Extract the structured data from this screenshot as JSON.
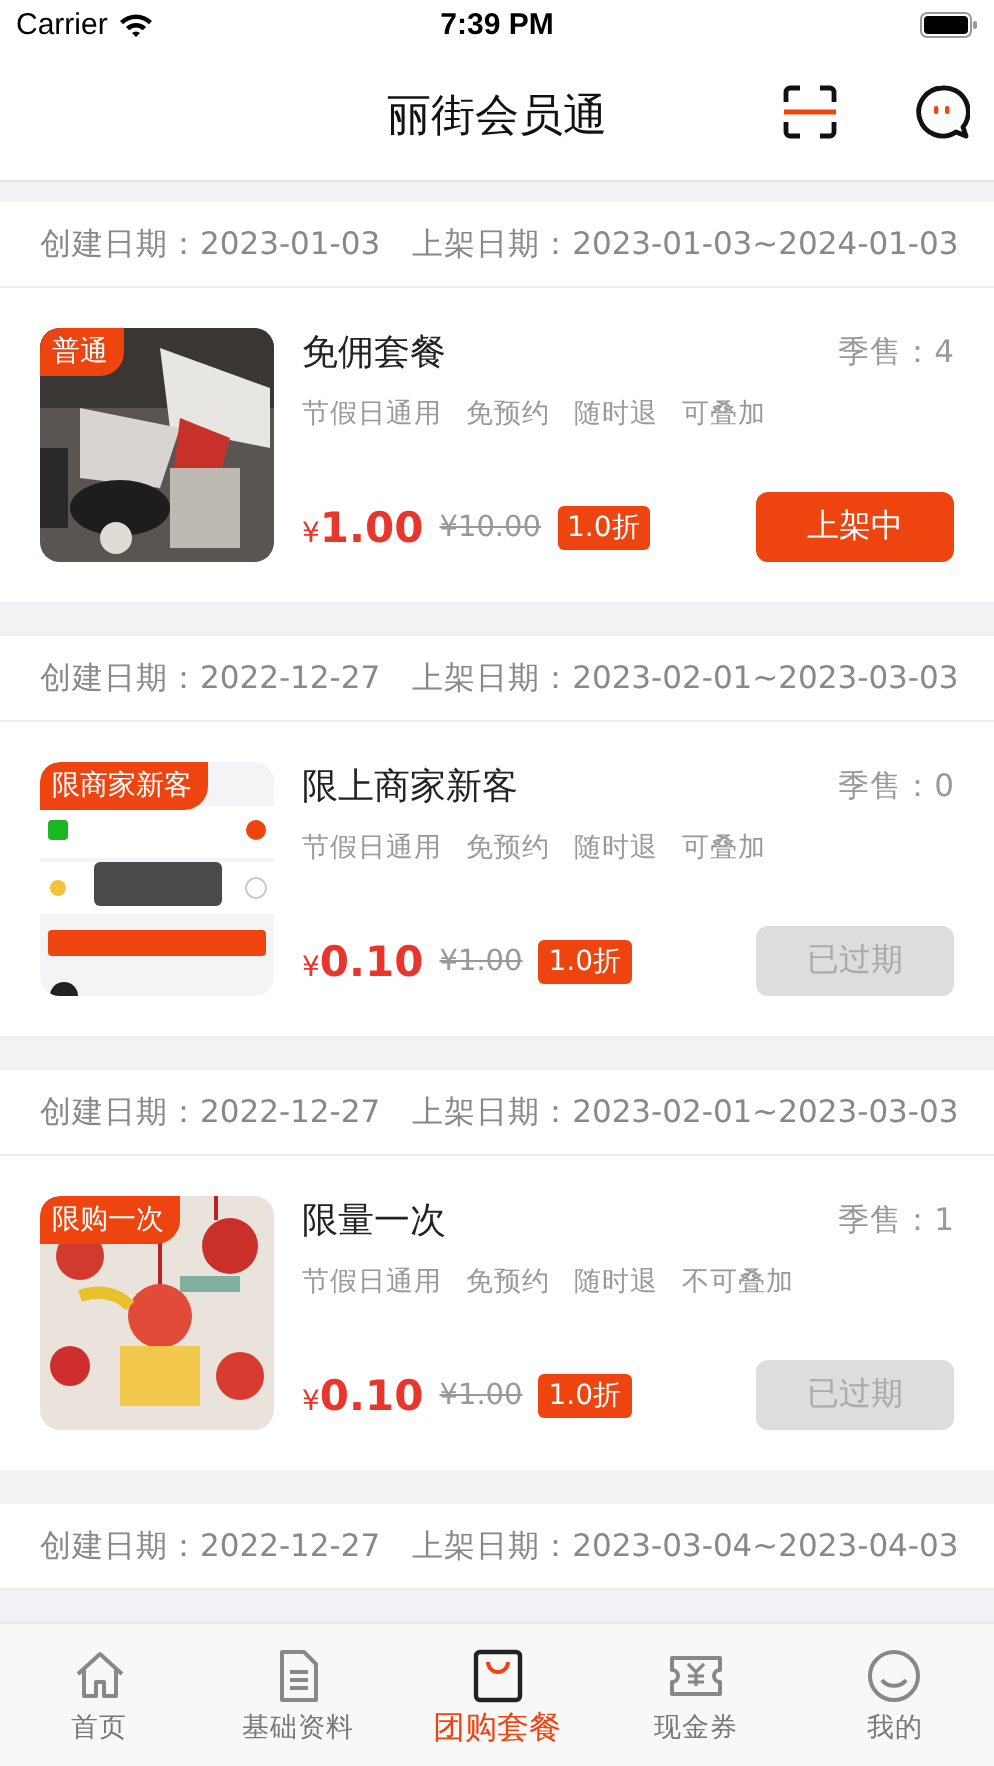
{
  "status_bar": {
    "carrier": "Carrier",
    "time": "7:39 PM"
  },
  "header": {
    "title": "丽街会员通"
  },
  "packages": [
    {
      "created": "创建日期：2023-01-03",
      "listed": "上架日期：2023-01-03~2024-01-03",
      "badge": "普通",
      "picture": {
        "kind": "picture"
      },
      "name": "免佣套餐",
      "sales": "季售：4",
      "tags": [
        "节假日通用",
        "免预约",
        "随时退",
        "可叠加"
      ],
      "currency": "¥",
      "price": "1.00",
      "original_price": "¥10.00",
      "discount": "1.0折",
      "button": {
        "label": "上架中",
        "disabled": false
      }
    },
    {
      "created": "创建日期：2022-12-27",
      "listed": "上架日期：2023-02-01~2023-03-03",
      "badge": "限商家新客",
      "picture": {
        "kind": "picture"
      },
      "name": "限上商家新客",
      "sales": "季售：0",
      "tags": [
        "节假日通用",
        "免预约",
        "随时退",
        "可叠加"
      ],
      "currency": "¥",
      "price": "0.10",
      "original_price": "¥1.00",
      "discount": "1.0折",
      "button": {
        "label": "已过期",
        "disabled": true
      }
    },
    {
      "created": "创建日期：2022-12-27",
      "listed": "上架日期：2023-02-01~2023-03-03",
      "badge": "限购一次",
      "picture": {
        "kind": "picture"
      },
      "name": "限量一次",
      "sales": "季售：1",
      "tags": [
        "节假日通用",
        "免预约",
        "随时退",
        "不可叠加"
      ],
      "currency": "¥",
      "price": "0.10",
      "original_price": "¥1.00",
      "discount": "1.0折",
      "button": {
        "label": "已过期",
        "disabled": true
      }
    },
    {
      "created": "创建日期：2022-12-27",
      "listed": "上架日期：2023-03-04~2023-04-03"
    }
  ],
  "tab_bar": [
    {
      "label": "首页",
      "selected": false
    },
    {
      "label": "基础资料",
      "selected": false
    },
    {
      "label": "团购套餐",
      "selected": true
    },
    {
      "label": "现金券",
      "selected": false
    },
    {
      "label": "我的",
      "selected": false
    }
  ]
}
